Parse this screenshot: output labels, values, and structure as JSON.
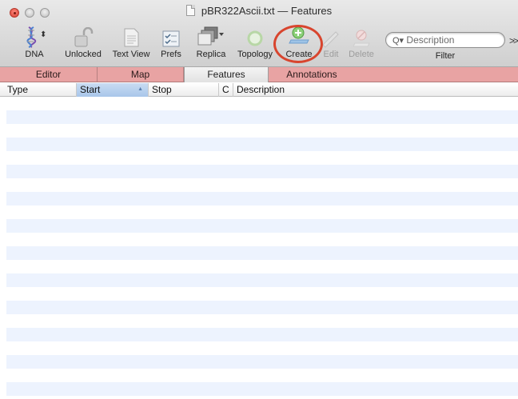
{
  "window": {
    "title": "pBR322Ascii.txt — Features"
  },
  "toolbar": {
    "dna": "DNA",
    "unlocked": "Unlocked",
    "text_view": "Text View",
    "prefs": "Prefs",
    "replica": "Replica",
    "topology": "Topology",
    "create": "Create",
    "edit": "Edit",
    "delete": "Delete",
    "filter_label": "Filter",
    "search_placeholder": "Description"
  },
  "tabs": [
    {
      "label": "Editor"
    },
    {
      "label": "Map"
    },
    {
      "label": "Features",
      "active": true
    },
    {
      "label": "Annotations"
    }
  ],
  "table": {
    "columns": [
      "Type",
      "Start",
      "Stop",
      "C",
      "Description"
    ],
    "sorted_column": "Start",
    "rows": []
  },
  "colors": {
    "tab_bar": "#e8a3a3",
    "highlight": "#d8452e",
    "row_stripe": "#edf3fe"
  }
}
